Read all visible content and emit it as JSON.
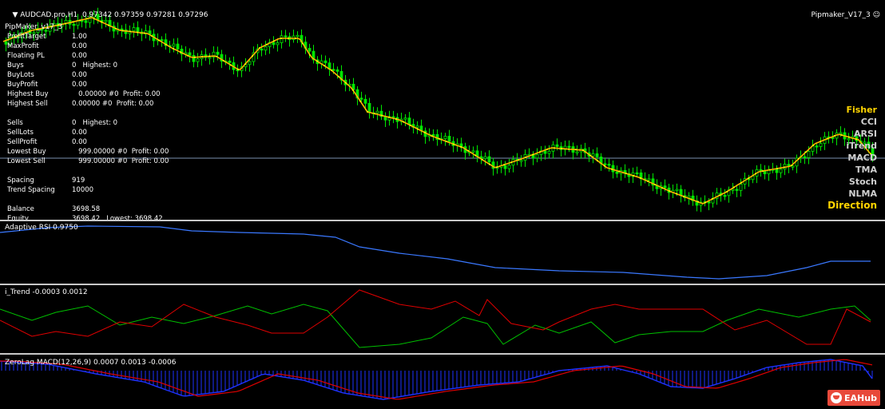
{
  "header": {
    "symbol": "AUDCAD.pro,H1",
    "ohlc": "0.97342 0.97359 0.97281 0.97296",
    "ea_name": "Pipmaker_V17_3",
    "ea_smile": "☺"
  },
  "ea_panel": {
    "title": "PipMaker_v17_3",
    "rows": [
      {
        "label": "ProfitTarget",
        "value": "1.00"
      },
      {
        "label": "MaxProfit",
        "value": "0.00"
      },
      {
        "label": "Floating PL",
        "value": "0.00"
      },
      {
        "label": "Buys",
        "value": "0   Highest: 0"
      },
      {
        "label": "BuyLots",
        "value": "0.00"
      },
      {
        "label": "BuyProfit",
        "value": "0.00"
      },
      {
        "label": "Highest Buy",
        "value": "   0.00000 #0  Profit: 0.00"
      },
      {
        "label": "Highest Sell",
        "value": "0.00000 #0  Profit: 0.00"
      },
      {
        "label": "",
        "value": ""
      },
      {
        "label": "Sells",
        "value": "0   Highest: 0"
      },
      {
        "label": "SellLots",
        "value": "0.00"
      },
      {
        "label": "SellProfit",
        "value": "0.00"
      },
      {
        "label": "Lowest Buy",
        "value": "   999.00000 #0  Profit: 0.00"
      },
      {
        "label": "Lowest Sell",
        "value": "   999.00000 #0  Profit: 0.00"
      },
      {
        "label": "",
        "value": ""
      },
      {
        "label": "Spacing",
        "value": "919"
      },
      {
        "label": "Trend Spacing",
        "value": "10000"
      },
      {
        "label": "",
        "value": ""
      },
      {
        "label": "Balance",
        "value": "3698.58"
      },
      {
        "label": "Equity",
        "value": "3698.42   Lowest: 3698.42"
      }
    ]
  },
  "indicators": {
    "fisher": "Fisher",
    "cci": "CCI",
    "arsi": "ARSI",
    "itrend": "iTrend",
    "macd": "MACD",
    "tma": "TMA",
    "stoch": "Stoch",
    "nlma": "NLMA",
    "direction": "Direction"
  },
  "subwindows": {
    "rsi_label": "Adaptive RSI 0.9750",
    "itrend_label": "i_Trend -0.0003 0.0012",
    "macd_label": "ZeroLag MACD(12,26,9) 0.0007 0.0013 -0.0006"
  },
  "watermark": "EAHub",
  "colors": {
    "bull": "#00e600",
    "bear": "#00e600",
    "ma_line": "#ffb000",
    "ma_dots": "#ffff00",
    "rsi": "#3a78ff",
    "trend_up": "#00c000",
    "trend_down": "#e00000",
    "macd_hist": "#1e32ff",
    "macd_signal": "#e00000",
    "fisher": "#ffd400",
    "direction": "#ffd400",
    "label_grey": "#d0d0d0",
    "hline": "#7a8fb0"
  }
}
